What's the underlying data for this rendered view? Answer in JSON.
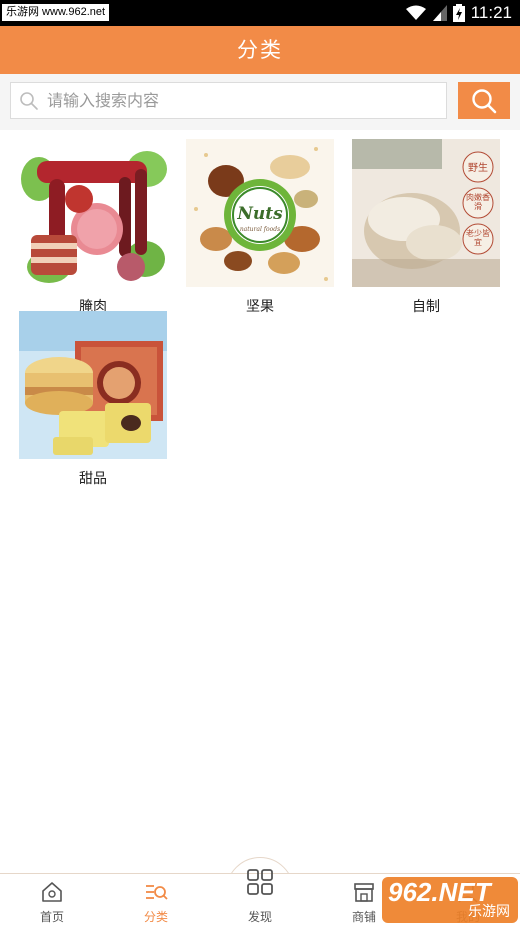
{
  "status_bar": {
    "watermark": "乐游网 www.962.net",
    "time": "11:21"
  },
  "header": {
    "title": "分类"
  },
  "search": {
    "placeholder": "请输入搜索内容"
  },
  "categories": [
    {
      "label": "腌肉"
    },
    {
      "label": "坚果",
      "image_text": "Nuts",
      "image_subtext": "natural foods"
    },
    {
      "label": "自制",
      "badges": [
        "野生",
        "肉嫩香滑",
        "老少皆宜"
      ]
    },
    {
      "label": "甜品"
    }
  ],
  "tab_bar": {
    "items": [
      {
        "label": "首页",
        "icon": "home-icon"
      },
      {
        "label": "分类",
        "icon": "category-icon",
        "active": true
      },
      {
        "label": "发现",
        "icon": "grid-icon"
      },
      {
        "label": "商铺",
        "icon": "shop-icon"
      },
      {
        "label": "我的",
        "icon": "user-icon"
      }
    ]
  },
  "watermark": {
    "main": "962.NET",
    "sub": "乐游网"
  },
  "colors": {
    "accent": "#f28b47",
    "background": "#ffffff",
    "search_bg": "#f5f5f5"
  }
}
